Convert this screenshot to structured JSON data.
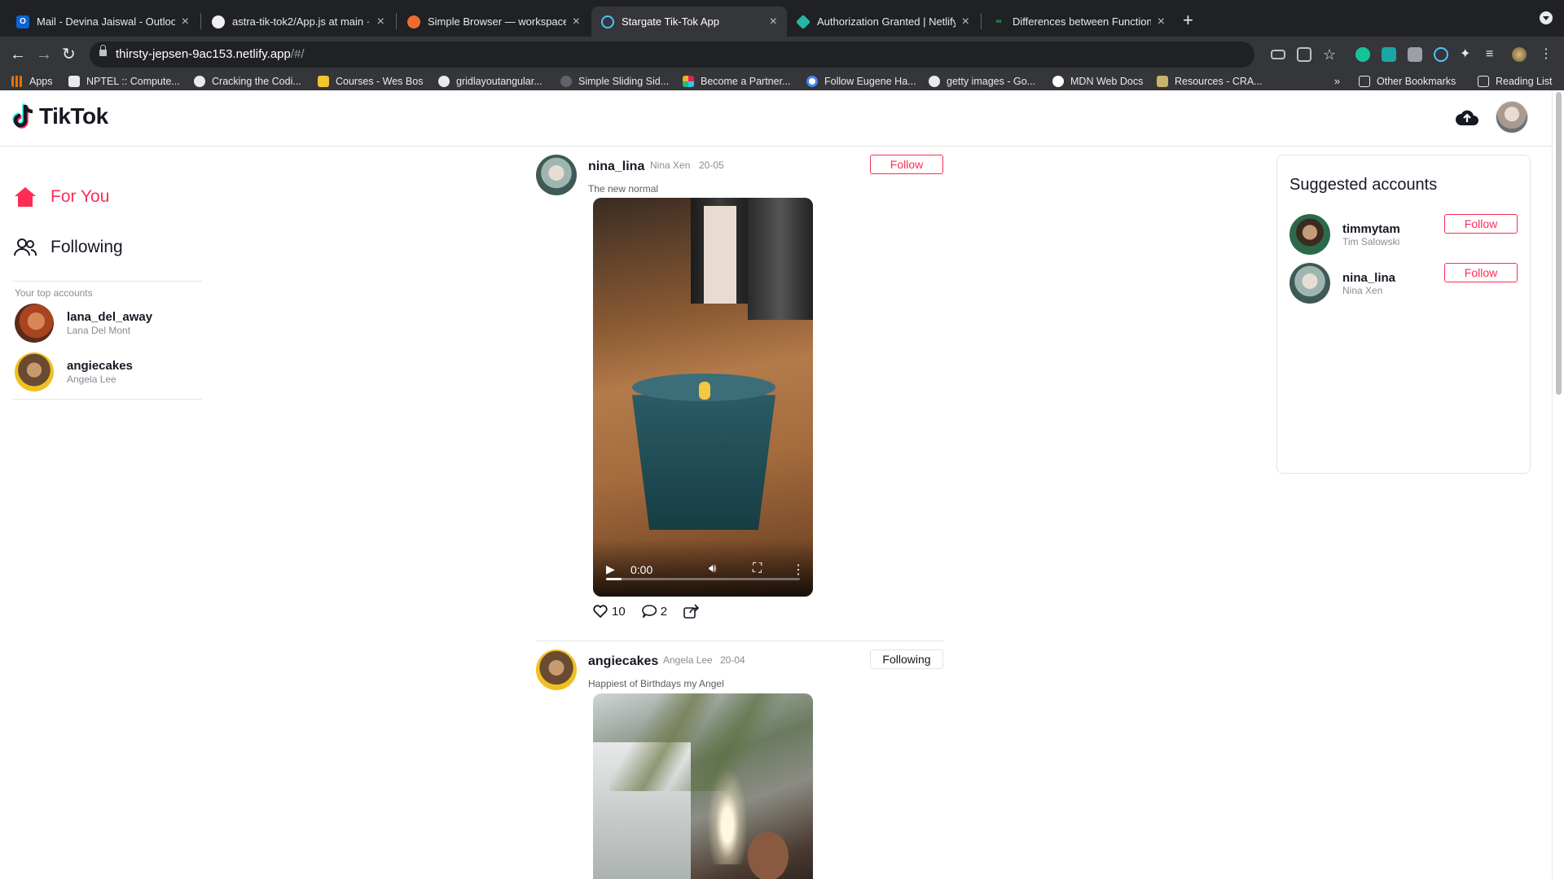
{
  "browser": {
    "tabs": [
      {
        "title": "Mail - Devina Jaiswal - Outlook",
        "color": "#0a64d6",
        "glyph": "O"
      },
      {
        "title": "astra-tik-tok2/App.js at main ·",
        "color": "#f0f0f0",
        "glyph": ""
      },
      {
        "title": "Simple Browser — workspace -",
        "color": "#f06c2e",
        "glyph": ""
      },
      {
        "title": "Stargate Tik-Tok App",
        "color": "#4fc3f7",
        "glyph": ""
      },
      {
        "title": "Authorization Granted | Netlify",
        "color": "#26b7a4",
        "glyph": ""
      },
      {
        "title": "Differences between Functiona",
        "color": "#34a853",
        "glyph": ""
      }
    ],
    "url_host": "thirsty-jepsen-9ac153.netlify.app",
    "url_path": "/#/",
    "bookmarks": [
      "Apps",
      "NPTEL :: Compute...",
      "Cracking the Codi...",
      "Courses - Wes Bos",
      "gridlayoutangular...",
      "Simple Sliding Sid...",
      "Become a Partner...",
      "Follow Eugene Ha...",
      "getty images - Go...",
      "MDN Web Docs",
      "Resources - CRA..."
    ],
    "bookmarks_overflow": "»",
    "other_bookmarks": "Other Bookmarks",
    "reading_list": "Reading List"
  },
  "app": {
    "brand": "TikTok",
    "nav": {
      "for_you": "For You",
      "following": "Following"
    },
    "top_accounts_label": "Your top accounts",
    "top_accounts": [
      {
        "username": "lana_del_away",
        "name": "Lana Del Mont"
      },
      {
        "username": "angiecakes",
        "name": "Angela Lee"
      }
    ],
    "posts": [
      {
        "username": "nina_lina",
        "name": "Nina Xen",
        "date": "20-05",
        "caption": "The new normal",
        "follow_label": "Follow",
        "video_time": "0:00",
        "video_progress": 0.08,
        "likes": "10",
        "comments": "2"
      },
      {
        "username": "angiecakes",
        "name": "Angela Lee",
        "date": "20-04",
        "caption": "Happiest of Birthdays my Angel",
        "follow_label": "Following"
      }
    ],
    "suggested": {
      "title": "Suggested accounts",
      "accounts": [
        {
          "username": "timmytam",
          "name": "Tim Salowski",
          "follow_label": "Follow"
        },
        {
          "username": "nina_lina",
          "name": "Nina Xen",
          "follow_label": "Follow"
        }
      ]
    },
    "colors": {
      "accent": "#fe2c55",
      "text": "#161823",
      "muted": "#8a8b91"
    }
  }
}
